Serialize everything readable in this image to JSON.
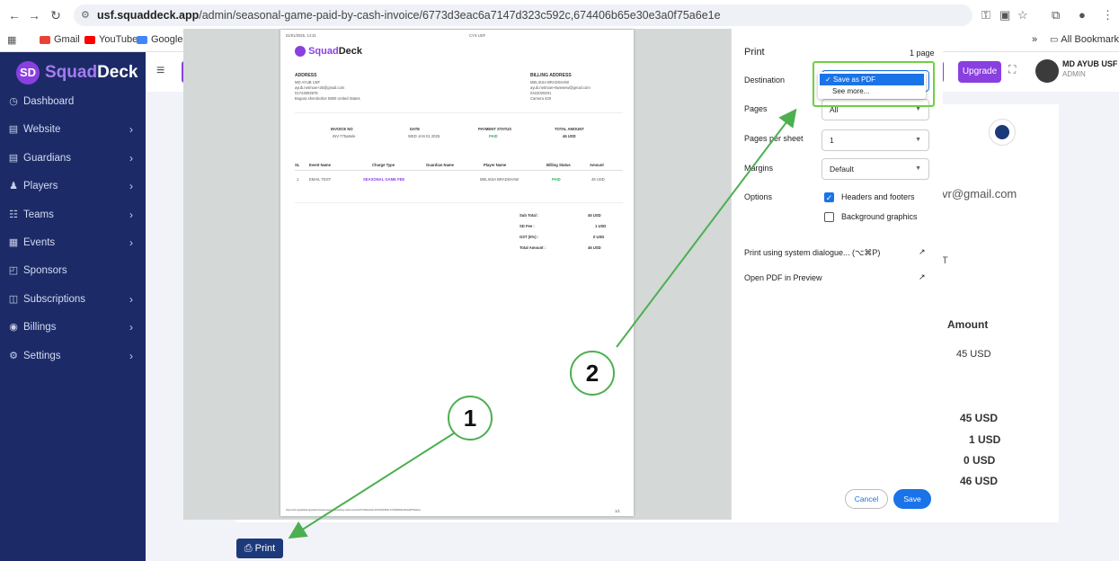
{
  "browser": {
    "url_host": "usf.squaddeck.app",
    "url_path": "/admin/seasonal-game-paid-by-cash-invoice/6773d3eac6a7147d323c592c,674406b65e30e3a0f75a6e1e",
    "bookmarks": [
      "Gmail",
      "YouTube",
      "Google Trans"
    ],
    "all_bookmarks": "All Bookmarks"
  },
  "app": {
    "brand_first": "Squad",
    "brand_second": "Deck",
    "user_name": "MD AYUB USF",
    "user_role": "ADMIN",
    "upgrade_label": "Upgrade",
    "print_button": "Print",
    "background": {
      "email_fragment": "vr@gmail.com",
      "amount_header": "Amount",
      "amount_value": "45 USD",
      "total_t": "T",
      "totals": [
        "45 USD",
        "1 USD",
        "0 USD",
        "46 USD"
      ]
    }
  },
  "sidebar": {
    "items": [
      {
        "label": "Dashboard",
        "icon": "dashboard-icon",
        "chevron": false
      },
      {
        "label": "Website",
        "icon": "website-icon",
        "chevron": true
      },
      {
        "label": "Guardians",
        "icon": "guardians-icon",
        "chevron": true
      },
      {
        "label": "Players",
        "icon": "players-icon",
        "chevron": true
      },
      {
        "label": "Teams",
        "icon": "teams-icon",
        "chevron": true
      },
      {
        "label": "Events",
        "icon": "events-icon",
        "chevron": true
      },
      {
        "label": "Sponsors",
        "icon": "sponsors-icon",
        "chevron": false
      },
      {
        "label": "Subscriptions",
        "icon": "subscriptions-icon",
        "chevron": true
      },
      {
        "label": "Billings",
        "icon": "billings-icon",
        "chevron": true
      },
      {
        "label": "Settings",
        "icon": "settings-icon",
        "chevron": true
      }
    ]
  },
  "invoice": {
    "header_date": "01/01/2025, 14:31",
    "header_title": "CYS USF",
    "address_title": "ADDRESS",
    "address_lines": [
      "MD AYUB USF",
      "ayub.netmow+25@gmail.com",
      "01724903976",
      "Bogura sherobohor 5800 United States"
    ],
    "billing_title": "BILLING ADDRESS",
    "billing_lines": [
      "MELISSA BRADSHAW",
      "ayub.netmow+6wewew@gmail.com",
      "0422020201",
      "Camera 420"
    ],
    "meta_headers": [
      "INVOICE NO",
      "DATE",
      "PAYMENT STATUS",
      "TOTAL AMOUNT"
    ],
    "meta_values": [
      "INV-775a6ele",
      "WED JAN 01 2025",
      "PAID",
      "46 USD"
    ],
    "table_headers": [
      "SL",
      "Event Name",
      "Charge Type",
      "Guardian Name",
      "Player Name",
      "Billing Status",
      "Amount"
    ],
    "row": [
      "1",
      "EMAIL TEST",
      "SEASONAL GAME FEE",
      "",
      "MELISSA BRADSHAW",
      "PAID",
      "45 USD"
    ],
    "summary_labels": [
      "Sub Total :",
      "SD Fee :",
      "GST (0%) :",
      "Total Amount :"
    ],
    "summary_values": [
      "45 USD",
      "1 USD",
      "0 USD",
      "46 USD"
    ],
    "footer_url": "https://usf.squaddeck.app/admin/seasonal-game-paid-by-cash-invoice/6773d3eac6a7147d323c592c,674406b65e30e3a0f75a6e1e",
    "footer_page": "1/1"
  },
  "print": {
    "title": "Print",
    "page_count": "1 page",
    "destination_label": "Destination",
    "destination_options": [
      "Save as PDF",
      "See more..."
    ],
    "pages_label": "Pages",
    "pages_value": "All",
    "pps_label": "Pages per sheet",
    "pps_value": "1",
    "margins_label": "Margins",
    "margins_value": "Default",
    "options_label": "Options",
    "opt_headers": "Headers and footers",
    "opt_background": "Background graphics",
    "system_dialogue": "Print using system dialogue... (⌥⌘P)",
    "open_pdf": "Open PDF in Preview",
    "cancel": "Cancel",
    "save": "Save"
  },
  "annotations": {
    "step1": "1",
    "step2": "2",
    "color": "#4caf50"
  }
}
